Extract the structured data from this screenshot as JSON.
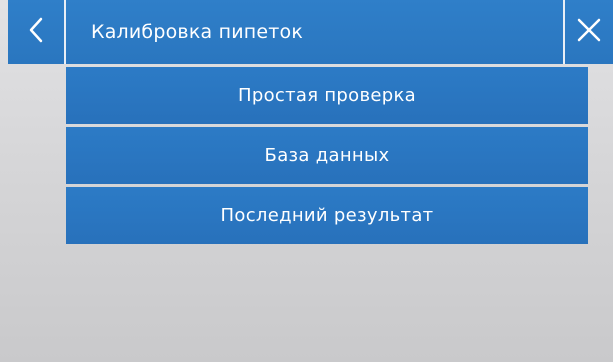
{
  "header": {
    "title": "Калибровка пипеток",
    "back_icon": "chevron-left-icon",
    "close_icon": "close-icon"
  },
  "menu": {
    "items": [
      {
        "label": "Простая проверка"
      },
      {
        "label": "База данных"
      },
      {
        "label": "Последний результат"
      }
    ]
  },
  "colors": {
    "accent": "#2c7bc6",
    "background": "#d6d6d8",
    "text_on_accent": "#ffffff"
  }
}
